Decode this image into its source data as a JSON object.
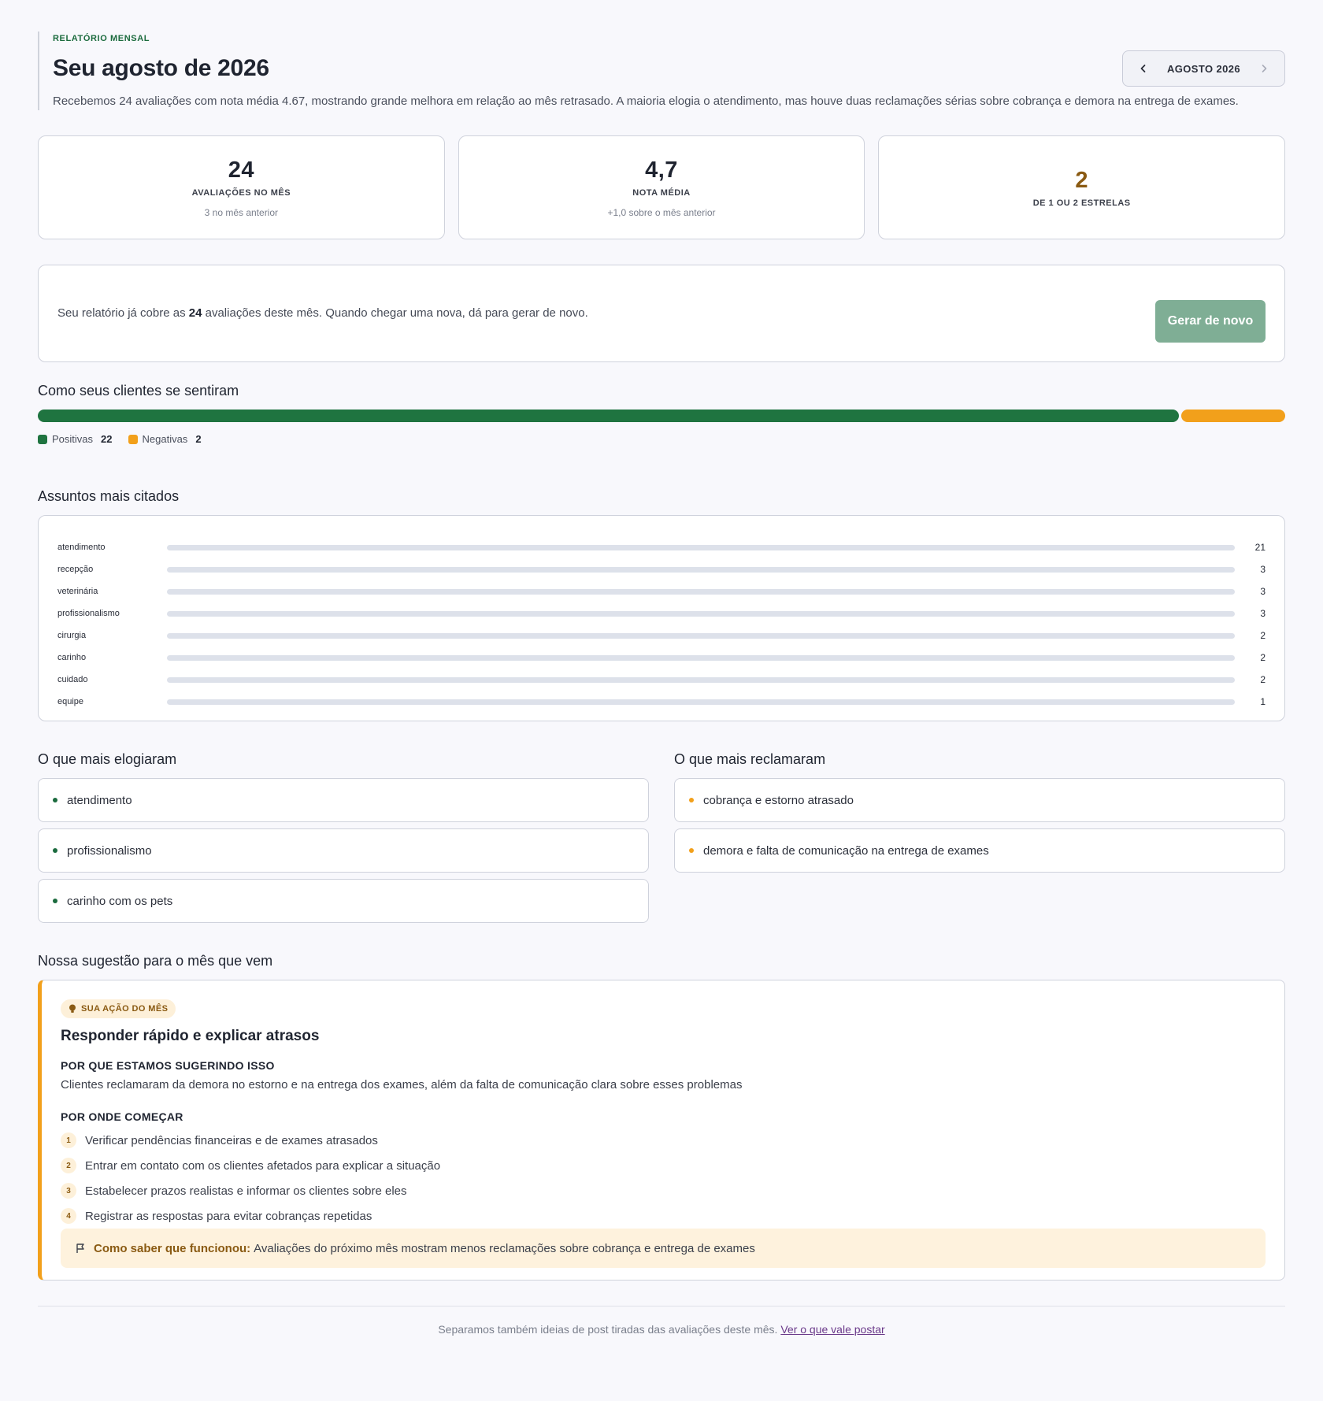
{
  "header": {
    "eyebrow": "RELATÓRIO MENSAL",
    "title": "Seu agosto de 2026",
    "summary": "Recebemos 24 avaliações com nota média 4.67, mostrando grande melhora em relação ao mês retrasado. A maioria elogia o atendimento, mas houve duas reclamações sérias sobre cobrança e demora na entrega de exames.",
    "month_label": "AGOSTO 2026"
  },
  "stats": [
    {
      "value": "24",
      "label": "AVALIAÇÕES NO MÊS",
      "sub": "3 no mês anterior"
    },
    {
      "value": "4,7",
      "label": "NOTA MÉDIA",
      "sub": "+1,0 sobre o mês anterior"
    },
    {
      "value": "2",
      "label": "DE 1 OU 2 ESTRELAS",
      "sub": ""
    }
  ],
  "regen": {
    "text_before": "Seu relatório já cobre as ",
    "count": "24",
    "text_after": " avaliações deste mês. Quando chegar uma nova, dá para gerar de novo.",
    "button_label": "Gerar de novo"
  },
  "sentiment": {
    "heading": "Como seus clientes se sentiram",
    "positive_label": "Positivas",
    "positive_count": 22,
    "negative_label": "Negativas",
    "negative_count": 2,
    "colors": {
      "positive": "#1f7440",
      "negative": "#f2a01b"
    }
  },
  "topics": {
    "heading": "Assuntos mais citados",
    "max": 21,
    "items": [
      {
        "label": "atendimento",
        "count": 21
      },
      {
        "label": "recepção",
        "count": 3
      },
      {
        "label": "veterinária",
        "count": 3
      },
      {
        "label": "profissionalismo",
        "count": 3
      },
      {
        "label": "cirurgia",
        "count": 2
      },
      {
        "label": "carinho",
        "count": 2
      },
      {
        "label": "cuidado",
        "count": 2
      },
      {
        "label": "equipe",
        "count": 1
      }
    ]
  },
  "praise": {
    "heading": "O que mais elogiaram",
    "items": [
      "atendimento",
      "profissionalismo",
      "carinho com os pets"
    ]
  },
  "complaints": {
    "heading": "O que mais reclamaram",
    "items": [
      "cobrança e estorno atrasado",
      "demora e falta de comunicação na entrega de exames"
    ]
  },
  "suggestion": {
    "heading": "Nossa sugestão para o mês que vem",
    "badge": "SUA AÇÃO DO MÊS",
    "title": "Responder rápido e explicar atrasos",
    "why_heading": "POR QUE ESTAMOS SUGERINDO ISSO",
    "why_text": "Clientes reclamaram da demora no estorno e na entrega dos exames, além da falta de comunicação clara sobre esses problemas",
    "start_heading": "POR ONDE COMEÇAR",
    "steps": [
      "Verificar pendências financeiras e de exames atrasados",
      "Entrar em contato com os clientes afetados para explicar a situação",
      "Estabelecer prazos realistas e informar os clientes sobre eles",
      "Registrar as respostas para evitar cobranças repetidas"
    ],
    "success_label": "Como saber que funcionou:",
    "success_text": "Avaliações do próximo mês mostram menos reclamações sobre cobrança e entrega de exames"
  },
  "footer": {
    "text": "Separamos também ideias de post tiradas das avaliações deste mês.",
    "link": "Ver o que vale postar"
  }
}
